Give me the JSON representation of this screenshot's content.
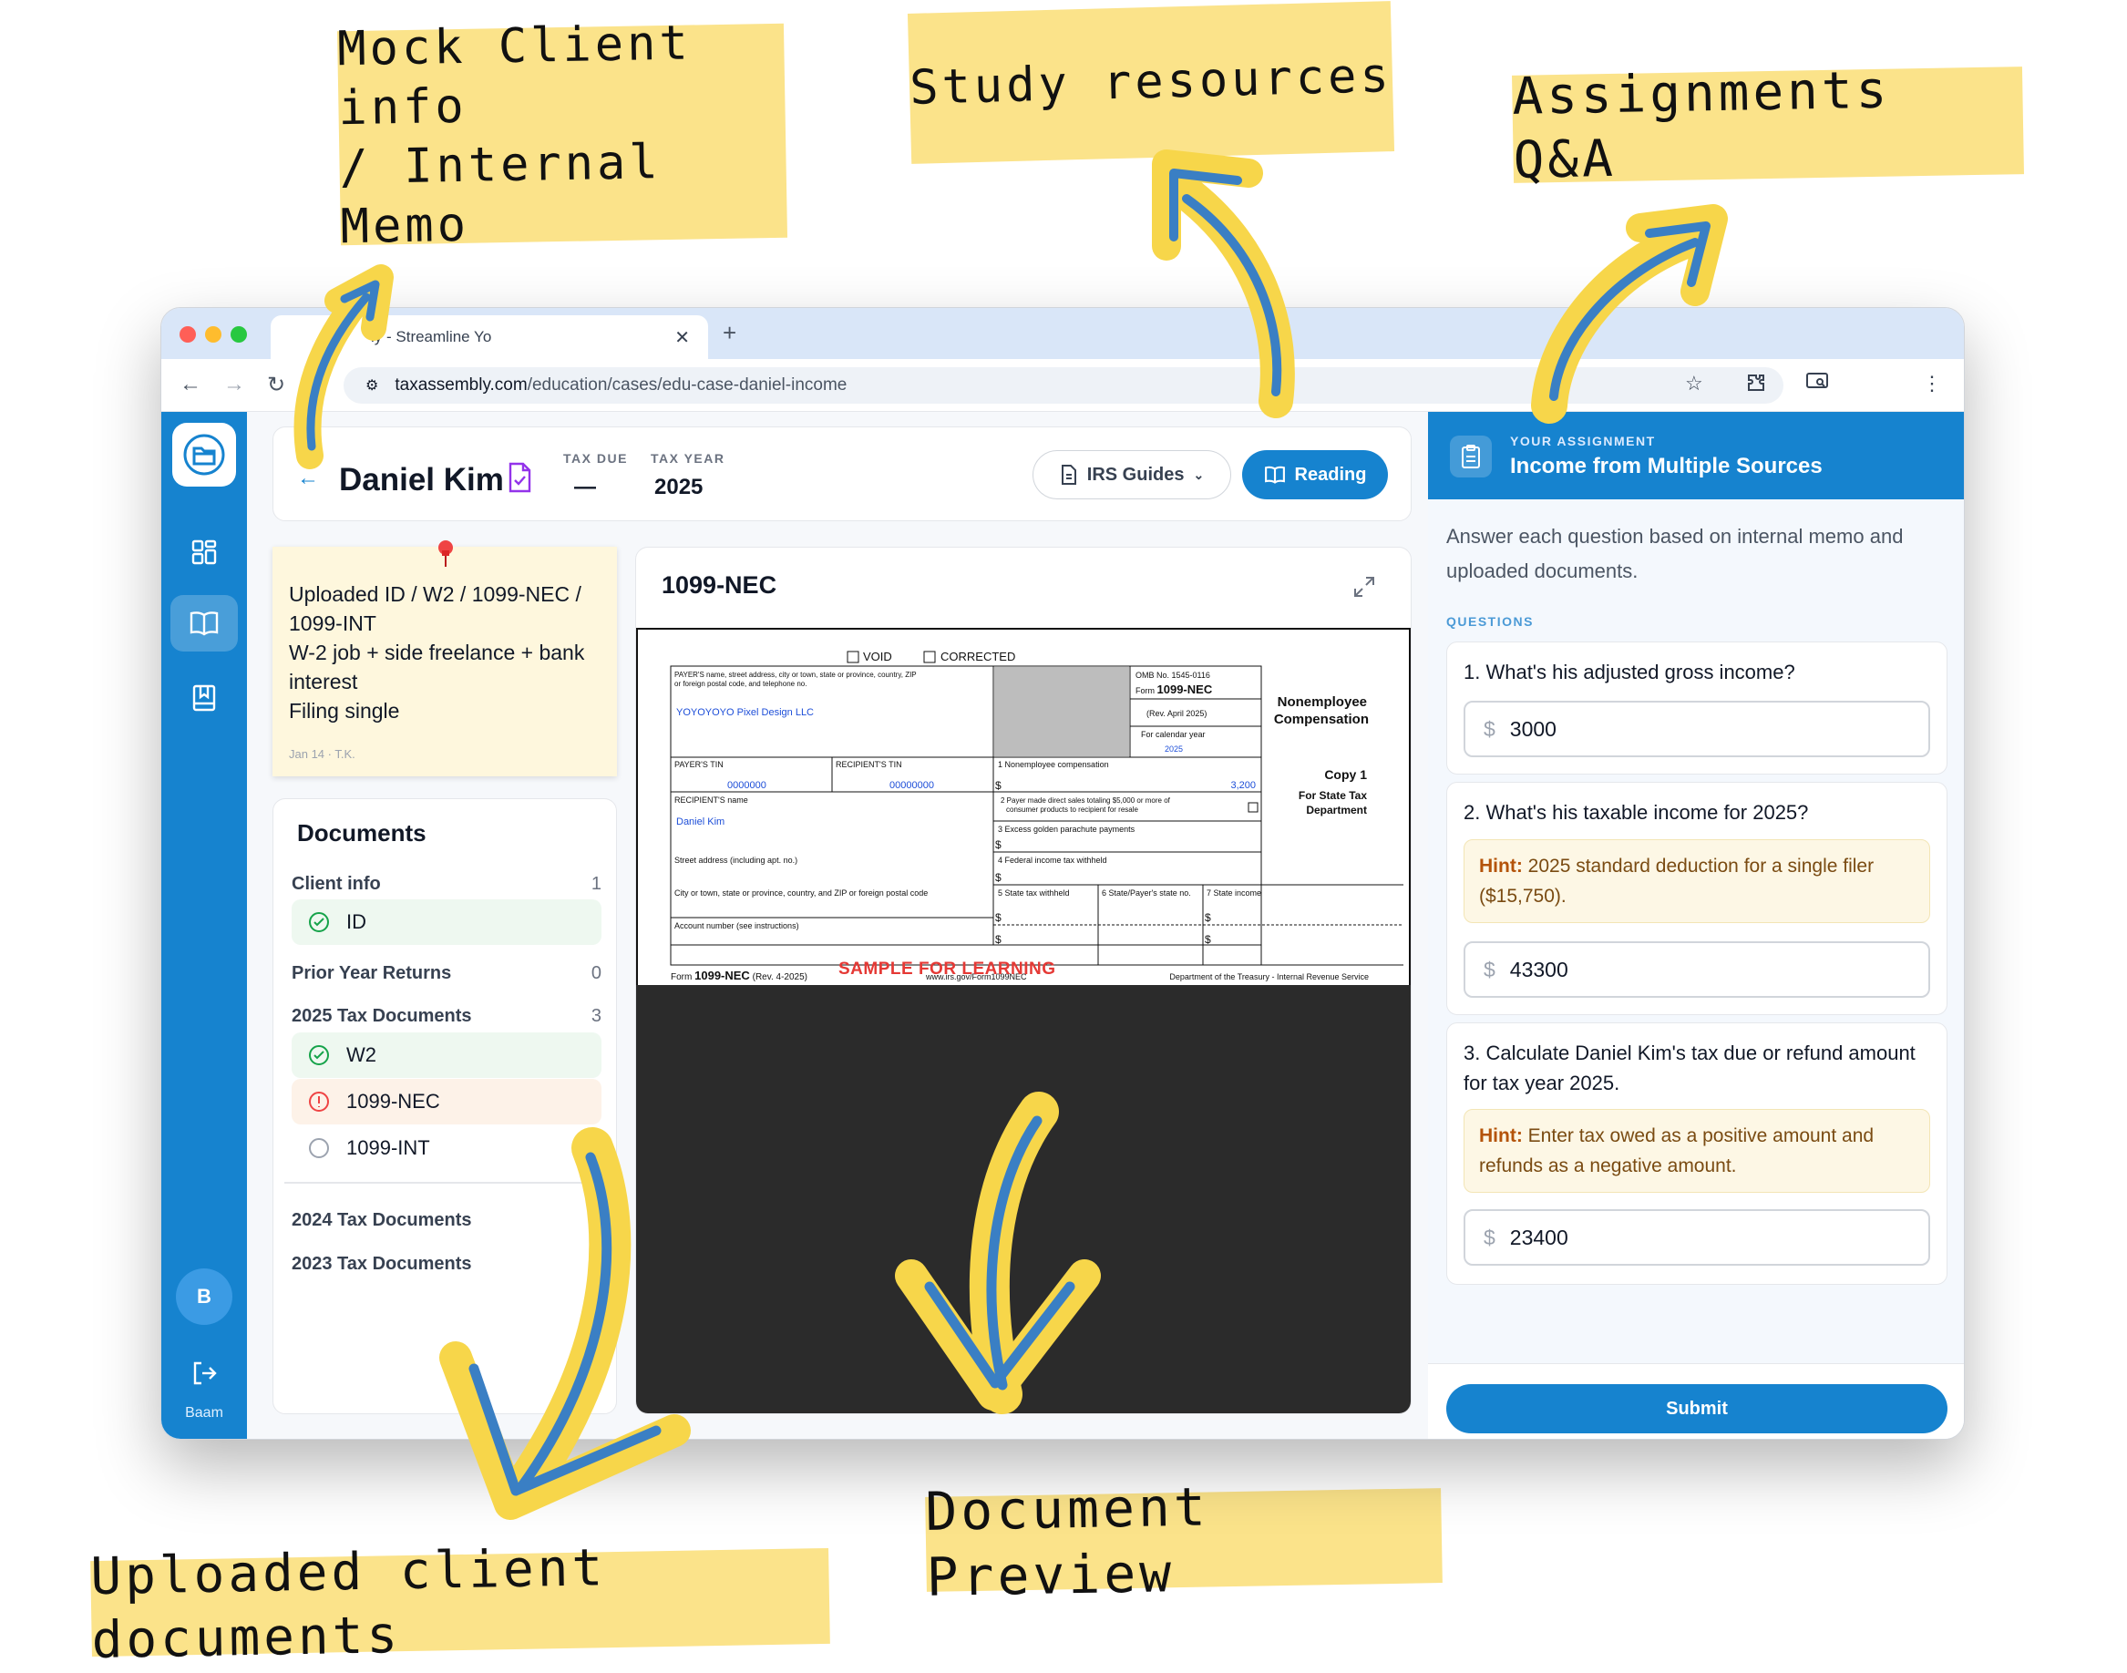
{
  "callouts": {
    "client_info": "Mock Client info\n/ Internal Memo",
    "study": "Study resources",
    "assignments": "Assignments Q&A",
    "uploaded": "Uploaded client documents",
    "preview": "Document Preview"
  },
  "browser": {
    "tab_title": "ly - Streamline Yo",
    "url_domain": "taxassembly.com",
    "url_path": "/education/cases/edu-case-daniel-income"
  },
  "header": {
    "client_name": "Daniel Kim",
    "tax_due_label": "TAX DUE",
    "tax_due_value": "—",
    "tax_year_label": "TAX YEAR",
    "tax_year_value": "2025",
    "guides_button": "IRS Guides",
    "reading_button": "Reading"
  },
  "memo": {
    "lines": [
      "Uploaded ID / W2 / 1099-NEC / 1099-INT",
      "W-2 job + side freelance + bank interest",
      "Filing single"
    ],
    "meta": "Jan 14 · T.K."
  },
  "documents": {
    "title": "Documents",
    "categories": [
      {
        "label": "Client info",
        "count": "1"
      },
      {
        "label": "Prior Year Returns",
        "count": "0"
      },
      {
        "label": "2025 Tax Documents",
        "count": "3"
      },
      {
        "label": "2024 Tax Documents"
      },
      {
        "label": "2023 Tax Documents"
      }
    ],
    "items": [
      {
        "label": "ID",
        "status": "complete"
      },
      {
        "label": "W2",
        "status": "complete"
      },
      {
        "label": "1099-NEC",
        "status": "warning"
      },
      {
        "label": "1099-INT",
        "status": "pending"
      }
    ]
  },
  "preview": {
    "title": "1099-NEC",
    "form": {
      "void": "VOID",
      "corrected": "CORRECTED",
      "payer_block": "PAYER'S name, street address, city or town, state or province, country, ZIP or foreign postal code, and telephone no.",
      "payer_name": "YOYOYOYO Pixel Design LLC",
      "omb": "OMB No. 1545-0116",
      "form_label": "Form",
      "form_name": "1099-NEC",
      "rev": "(Rev. April 2025)",
      "calendar_year_label": "For calendar year",
      "calendar_year": "2025",
      "title_line1": "Nonemployee",
      "title_line2": "Compensation",
      "payer_tin_label": "PAYER'S TIN",
      "payer_tin": "0000000",
      "recipient_tin_label": "RECIPIENT'S TIN",
      "recipient_tin": "00000000",
      "box1_label": "1 Nonemployee compensation",
      "box1_value": "3,200",
      "copy": "Copy 1",
      "copy_sub1": "For State Tax",
      "copy_sub2": "Department",
      "recipient_name_label": "RECIPIENT'S name",
      "recipient_name": "Daniel Kim",
      "box2_label": "2 Payer made direct sales totaling $5,000 or more of consumer products to recipient for resale",
      "box3_label": "3 Excess golden parachute payments",
      "street_label": "Street address (including apt. no.)",
      "box4_label": "4 Federal income tax withheld",
      "city_label": "City or town, state or province, country, and ZIP or foreign postal code",
      "box5_label": "5 State tax withheld",
      "box6_label": "6 State/Payer's state no.",
      "box7_label": "7 State income",
      "account_label": "Account number (see instructions)",
      "dollar": "$",
      "footer_form": "Form",
      "footer_name": "1099-NEC",
      "footer_rev": "(Rev. 4-2025)",
      "footer_url": "www.irs.gov/Form1099NEC",
      "footer_dept": "Department of the Treasury - Internal Revenue Service",
      "sample": "SAMPLE FOR LEARNING"
    }
  },
  "assignment": {
    "kicker": "YOUR ASSIGNMENT",
    "title": "Income from Multiple Sources",
    "intro": "Answer each question based on internal memo and uploaded documents.",
    "questions_label": "QUESTIONS",
    "currency": "$",
    "questions": [
      {
        "text": "1. What's his adjusted gross income?",
        "answer": "3000"
      },
      {
        "text": "2. What's his taxable income for 2025?",
        "hint_label": "Hint:",
        "hint": "2025 standard deduction for a single filer ($15,750).",
        "answer": "43300"
      },
      {
        "text": "3. Calculate Daniel Kim's tax due or refund amount for tax year 2025.",
        "hint_label": "Hint:",
        "hint": "Enter tax owed as a positive amount and refunds as a negative amount.",
        "answer": "23400"
      }
    ],
    "submit": "Submit"
  },
  "rail": {
    "user_initial": "B",
    "user_name": "Baam"
  },
  "colors": {
    "brand": "#1683cf",
    "callout": "#fbe38a",
    "arrow": "#3a7fc4",
    "memo": "#fef7dd",
    "sample_red": "#e53935"
  },
  "icons": [
    "folder-logo-icon",
    "grid-icon",
    "book-open-icon",
    "bookmark-icon",
    "logout-icon",
    "document-check-icon",
    "document-icon",
    "chevron-down-icon",
    "expand-icon",
    "clipboard-icon",
    "check-circle-icon",
    "alert-circle-icon",
    "empty-circle-icon",
    "pushpin-icon",
    "star-icon",
    "puzzle-icon",
    "cast-icon",
    "more-vertical-icon",
    "back-arrow-icon",
    "forward-arrow-icon",
    "reload-icon",
    "site-settings-icon"
  ]
}
